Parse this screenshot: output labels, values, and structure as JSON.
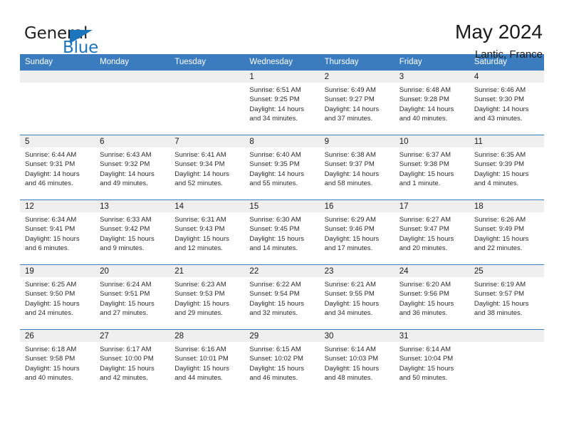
{
  "brand": {
    "name_top": "General",
    "name_bottom": "Blue",
    "triangle_icon": "brand-triangle-icon",
    "accent_color": "#1b75bc"
  },
  "header": {
    "title": "May 2024",
    "subtitle": "Lantic, France"
  },
  "theme": {
    "header_blue": "#3a7cbe",
    "daynum_band": "#efefef",
    "text": "#1a1a1a"
  },
  "weekdays": [
    "Sunday",
    "Monday",
    "Tuesday",
    "Wednesday",
    "Thursday",
    "Friday",
    "Saturday"
  ],
  "labels": {
    "sunrise_prefix": "Sunrise:",
    "sunset_prefix": "Sunset:",
    "daylight_prefix": "Daylight:"
  },
  "weeks": [
    [
      {
        "empty": true
      },
      {
        "empty": true
      },
      {
        "empty": true
      },
      {
        "day": "1",
        "sunrise": "Sunrise: 6:51 AM",
        "sunset": "Sunset: 9:25 PM",
        "daylight1": "Daylight: 14 hours",
        "daylight2": "and 34 minutes."
      },
      {
        "day": "2",
        "sunrise": "Sunrise: 6:49 AM",
        "sunset": "Sunset: 9:27 PM",
        "daylight1": "Daylight: 14 hours",
        "daylight2": "and 37 minutes."
      },
      {
        "day": "3",
        "sunrise": "Sunrise: 6:48 AM",
        "sunset": "Sunset: 9:28 PM",
        "daylight1": "Daylight: 14 hours",
        "daylight2": "and 40 minutes."
      },
      {
        "day": "4",
        "sunrise": "Sunrise: 6:46 AM",
        "sunset": "Sunset: 9:30 PM",
        "daylight1": "Daylight: 14 hours",
        "daylight2": "and 43 minutes."
      }
    ],
    [
      {
        "day": "5",
        "sunrise": "Sunrise: 6:44 AM",
        "sunset": "Sunset: 9:31 PM",
        "daylight1": "Daylight: 14 hours",
        "daylight2": "and 46 minutes."
      },
      {
        "day": "6",
        "sunrise": "Sunrise: 6:43 AM",
        "sunset": "Sunset: 9:32 PM",
        "daylight1": "Daylight: 14 hours",
        "daylight2": "and 49 minutes."
      },
      {
        "day": "7",
        "sunrise": "Sunrise: 6:41 AM",
        "sunset": "Sunset: 9:34 PM",
        "daylight1": "Daylight: 14 hours",
        "daylight2": "and 52 minutes."
      },
      {
        "day": "8",
        "sunrise": "Sunrise: 6:40 AM",
        "sunset": "Sunset: 9:35 PM",
        "daylight1": "Daylight: 14 hours",
        "daylight2": "and 55 minutes."
      },
      {
        "day": "9",
        "sunrise": "Sunrise: 6:38 AM",
        "sunset": "Sunset: 9:37 PM",
        "daylight1": "Daylight: 14 hours",
        "daylight2": "and 58 minutes."
      },
      {
        "day": "10",
        "sunrise": "Sunrise: 6:37 AM",
        "sunset": "Sunset: 9:38 PM",
        "daylight1": "Daylight: 15 hours",
        "daylight2": "and 1 minute."
      },
      {
        "day": "11",
        "sunrise": "Sunrise: 6:35 AM",
        "sunset": "Sunset: 9:39 PM",
        "daylight1": "Daylight: 15 hours",
        "daylight2": "and 4 minutes."
      }
    ],
    [
      {
        "day": "12",
        "sunrise": "Sunrise: 6:34 AM",
        "sunset": "Sunset: 9:41 PM",
        "daylight1": "Daylight: 15 hours",
        "daylight2": "and 6 minutes."
      },
      {
        "day": "13",
        "sunrise": "Sunrise: 6:33 AM",
        "sunset": "Sunset: 9:42 PM",
        "daylight1": "Daylight: 15 hours",
        "daylight2": "and 9 minutes."
      },
      {
        "day": "14",
        "sunrise": "Sunrise: 6:31 AM",
        "sunset": "Sunset: 9:43 PM",
        "daylight1": "Daylight: 15 hours",
        "daylight2": "and 12 minutes."
      },
      {
        "day": "15",
        "sunrise": "Sunrise: 6:30 AM",
        "sunset": "Sunset: 9:45 PM",
        "daylight1": "Daylight: 15 hours",
        "daylight2": "and 14 minutes."
      },
      {
        "day": "16",
        "sunrise": "Sunrise: 6:29 AM",
        "sunset": "Sunset: 9:46 PM",
        "daylight1": "Daylight: 15 hours",
        "daylight2": "and 17 minutes."
      },
      {
        "day": "17",
        "sunrise": "Sunrise: 6:27 AM",
        "sunset": "Sunset: 9:47 PM",
        "daylight1": "Daylight: 15 hours",
        "daylight2": "and 20 minutes."
      },
      {
        "day": "18",
        "sunrise": "Sunrise: 6:26 AM",
        "sunset": "Sunset: 9:49 PM",
        "daylight1": "Daylight: 15 hours",
        "daylight2": "and 22 minutes."
      }
    ],
    [
      {
        "day": "19",
        "sunrise": "Sunrise: 6:25 AM",
        "sunset": "Sunset: 9:50 PM",
        "daylight1": "Daylight: 15 hours",
        "daylight2": "and 24 minutes."
      },
      {
        "day": "20",
        "sunrise": "Sunrise: 6:24 AM",
        "sunset": "Sunset: 9:51 PM",
        "daylight1": "Daylight: 15 hours",
        "daylight2": "and 27 minutes."
      },
      {
        "day": "21",
        "sunrise": "Sunrise: 6:23 AM",
        "sunset": "Sunset: 9:53 PM",
        "daylight1": "Daylight: 15 hours",
        "daylight2": "and 29 minutes."
      },
      {
        "day": "22",
        "sunrise": "Sunrise: 6:22 AM",
        "sunset": "Sunset: 9:54 PM",
        "daylight1": "Daylight: 15 hours",
        "daylight2": "and 32 minutes."
      },
      {
        "day": "23",
        "sunrise": "Sunrise: 6:21 AM",
        "sunset": "Sunset: 9:55 PM",
        "daylight1": "Daylight: 15 hours",
        "daylight2": "and 34 minutes."
      },
      {
        "day": "24",
        "sunrise": "Sunrise: 6:20 AM",
        "sunset": "Sunset: 9:56 PM",
        "daylight1": "Daylight: 15 hours",
        "daylight2": "and 36 minutes."
      },
      {
        "day": "25",
        "sunrise": "Sunrise: 6:19 AM",
        "sunset": "Sunset: 9:57 PM",
        "daylight1": "Daylight: 15 hours",
        "daylight2": "and 38 minutes."
      }
    ],
    [
      {
        "day": "26",
        "sunrise": "Sunrise: 6:18 AM",
        "sunset": "Sunset: 9:58 PM",
        "daylight1": "Daylight: 15 hours",
        "daylight2": "and 40 minutes."
      },
      {
        "day": "27",
        "sunrise": "Sunrise: 6:17 AM",
        "sunset": "Sunset: 10:00 PM",
        "daylight1": "Daylight: 15 hours",
        "daylight2": "and 42 minutes."
      },
      {
        "day": "28",
        "sunrise": "Sunrise: 6:16 AM",
        "sunset": "Sunset: 10:01 PM",
        "daylight1": "Daylight: 15 hours",
        "daylight2": "and 44 minutes."
      },
      {
        "day": "29",
        "sunrise": "Sunrise: 6:15 AM",
        "sunset": "Sunset: 10:02 PM",
        "daylight1": "Daylight: 15 hours",
        "daylight2": "and 46 minutes."
      },
      {
        "day": "30",
        "sunrise": "Sunrise: 6:14 AM",
        "sunset": "Sunset: 10:03 PM",
        "daylight1": "Daylight: 15 hours",
        "daylight2": "and 48 minutes."
      },
      {
        "day": "31",
        "sunrise": "Sunrise: 6:14 AM",
        "sunset": "Sunset: 10:04 PM",
        "daylight1": "Daylight: 15 hours",
        "daylight2": "and 50 minutes."
      },
      {
        "empty": true
      }
    ]
  ]
}
